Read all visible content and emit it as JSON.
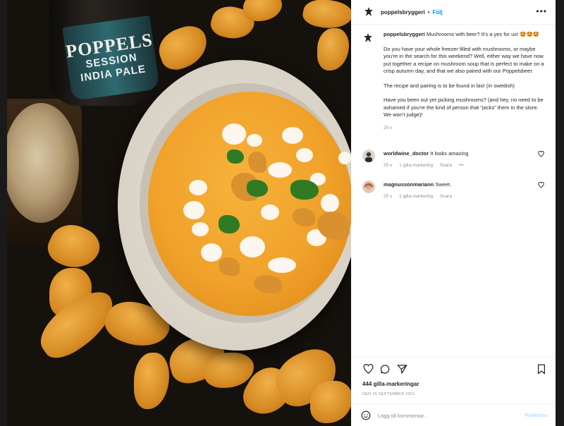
{
  "post": {
    "photo": {
      "bottle_brand": "POPPELS",
      "bottle_line1": "SESSION",
      "bottle_line2": "INDIA PALE"
    }
  },
  "header": {
    "username": "poppelsbryggeri",
    "separator": "•",
    "follow_label": "Följ",
    "more_label": "•••"
  },
  "caption": {
    "username": "poppelsbryggeri",
    "intro": "Mushrooms with beer? It's a yes for us! 🤩🤩🤩",
    "paragraph1": "Do you have your whole freezer filled with mushrooms, or maybe you're in the search for this weekend? Well, either way we have now put together a recipe on mushroom soup that is perfect to make on a crisp autumn day, and that we also paired with our Poppelsbeer.",
    "paragraph2": "The recipe and pairing is to be found in bio! (in swedish)",
    "paragraph3": "Have you been out yet picking mushrooms? (and hey, no need to be ashamed if you're the kind of person that \"picks\" them in the store. We won't judge)!",
    "time": "25 v"
  },
  "comments": [
    {
      "username": "worldwine_doctor",
      "text": "It looks amazing",
      "time": "25 v",
      "likes": "1 gilla-markering",
      "reply": "Svara",
      "more": "•••"
    },
    {
      "username": "magnussonmariann",
      "text": "Sweet.",
      "time": "25 v",
      "likes": "1 gilla-markering",
      "reply": "Svara"
    }
  ],
  "likes_count": "444 gilla-markeringar",
  "date": "DEN 15 SEPTEMBER 2021",
  "add_comment": {
    "placeholder": "Lägg till kommentar...",
    "publish_label": "Publicera"
  },
  "icons": [
    "logo-icon",
    "heart-icon",
    "comment-icon",
    "share-icon",
    "bookmark-icon",
    "emoji-icon"
  ],
  "colors": {
    "follow": "#0095f6",
    "publish_disabled": "#b2dffc",
    "meta_gray": "#8e8e8e"
  }
}
